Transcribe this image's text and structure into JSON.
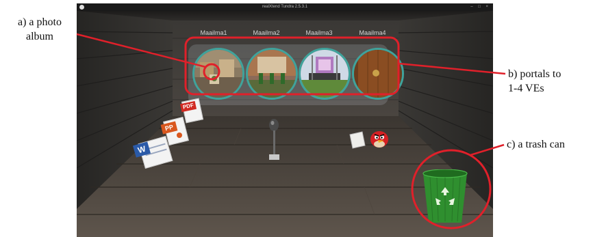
{
  "window": {
    "title": "realXtend Tundra 2.5.3.1",
    "controls": "– □ ×"
  },
  "portals": [
    {
      "label": "Maailma1"
    },
    {
      "label": "Maailma2"
    },
    {
      "label": "Maailma3"
    },
    {
      "label": "Maailma4"
    }
  ],
  "doc_icons": {
    "pdf": "PDF",
    "ppt": "PP",
    "word": "W"
  },
  "annotations": {
    "photo_album": [
      "a) a photo",
      "album"
    ],
    "portals": [
      "b) portals to",
      "1-4 VEs"
    ],
    "trash": "c) a trash can"
  },
  "colors": {
    "highlight_red": "#e0202a",
    "portal_ring": "#3fa39c",
    "trash_green": "#2f8f2f"
  }
}
